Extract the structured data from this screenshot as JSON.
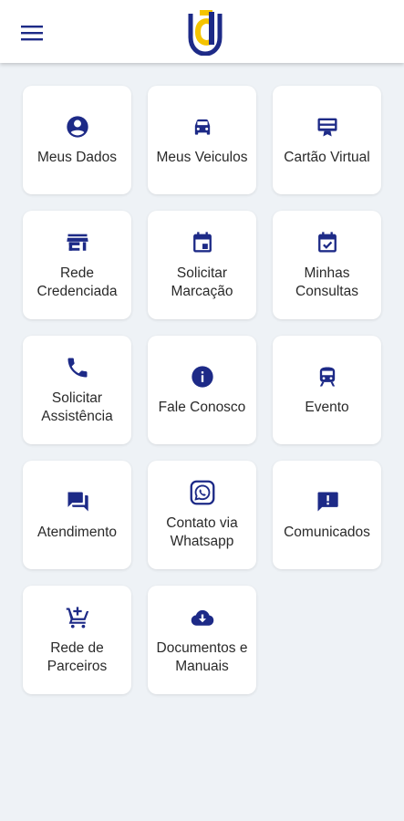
{
  "colors": {
    "accent": "#1d2a87",
    "logo_yellow": "#f5c400",
    "background": "#eef2f6"
  },
  "header": {
    "menu_icon": "hamburger-menu-icon",
    "logo": "app-logo-icon"
  },
  "tiles": [
    {
      "label": "Meus Dados",
      "icon": "account-circle-icon"
    },
    {
      "label": "Meus Veiculos",
      "icon": "car-icon"
    },
    {
      "label": "Cartão Virtual",
      "icon": "card-icon"
    },
    {
      "label": "Rede\nCredenciada",
      "icon": "store-icon"
    },
    {
      "label": "Solicitar\nMarcação",
      "icon": "calendar-icon"
    },
    {
      "label": "Minhas\nConsultas",
      "icon": "calendar-check-icon"
    },
    {
      "label": "Solicitar\nAssistência",
      "icon": "phone-icon"
    },
    {
      "label": "Fale Conosco",
      "icon": "info-icon"
    },
    {
      "label": "Evento",
      "icon": "train-icon"
    },
    {
      "label": "Atendimento",
      "icon": "chat-icon"
    },
    {
      "label": "Contato via\nWhatsapp",
      "icon": "whatsapp-icon"
    },
    {
      "label": "Comunicados",
      "icon": "announcement-icon"
    },
    {
      "label": "Rede de\nParceiros",
      "icon": "cart-plus-icon"
    },
    {
      "label": "Documentos e\nManuais",
      "icon": "cloud-download-icon"
    }
  ]
}
